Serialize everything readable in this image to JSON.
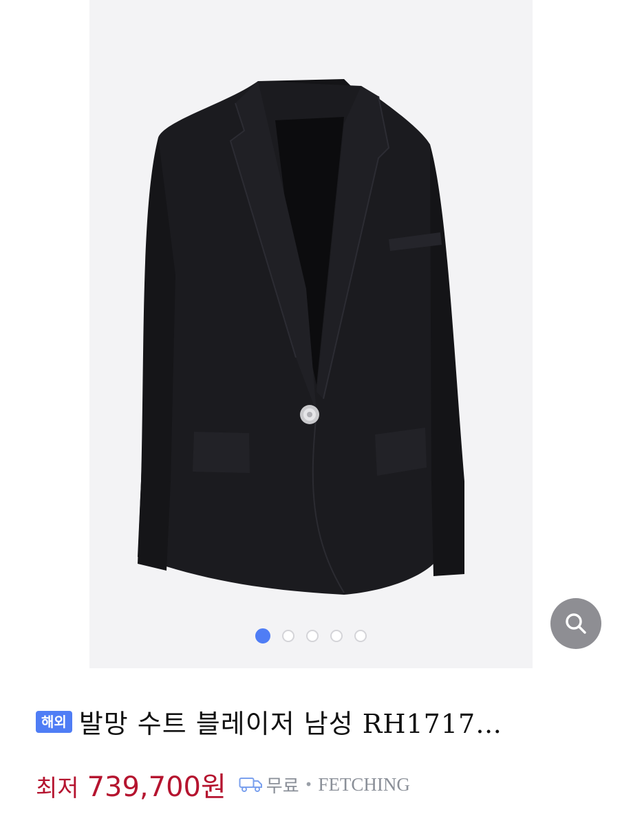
{
  "product": {
    "badge": "해외",
    "title": "발망 수트 블레이저 남성 RH1717…",
    "price_label": "최저",
    "price": "739,700원",
    "shipping_label": "무료",
    "separator": "•",
    "seller": "FETCHING"
  },
  "gallery": {
    "image_count": 5,
    "active_index": 0
  },
  "icons": {
    "zoom": "magnifier-icon",
    "shipping": "truck-icon"
  },
  "colors": {
    "accent": "#4f7df5",
    "price": "#b5142f",
    "muted": "#8a8f98"
  }
}
